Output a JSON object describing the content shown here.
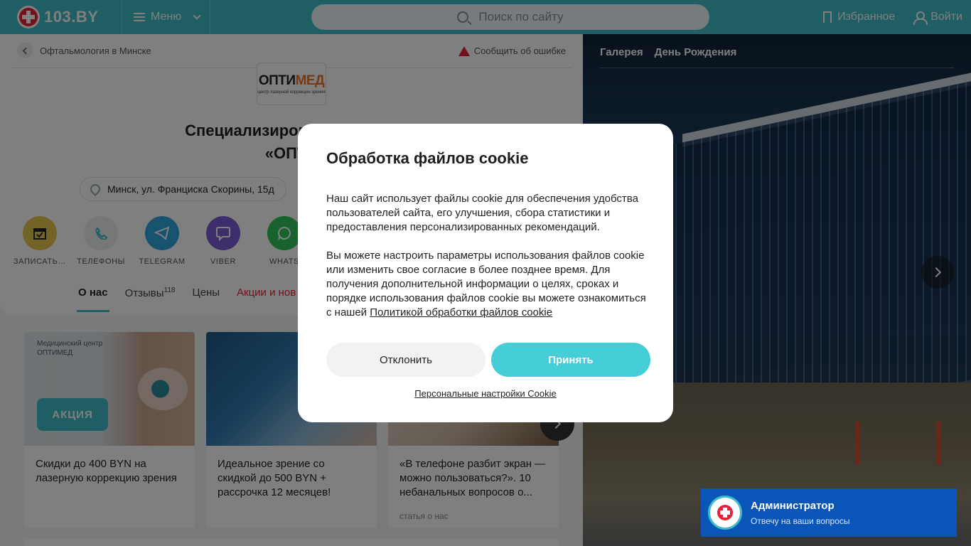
{
  "header": {
    "logo_text": "103.BY",
    "menu_label": "Меню",
    "search_placeholder": "Поиск по сайту",
    "favorites_label": "Избранное",
    "login_label": "Войти"
  },
  "breadcrumb": {
    "label": "Офтальмология в Минске"
  },
  "report_error_label": "Сообщить об ошибке",
  "clinic": {
    "logo_name_a": "ОПТИ",
    "logo_name_b": "МЕД",
    "logo_sub": "центр лазерной коррекции зрения",
    "title_line1": "Специализированный цент",
    "title_line2": "«ОПТИ",
    "address": "Минск, ул. Франциска Скорины, 15д"
  },
  "actions": [
    {
      "label": "ЗАПИСАТЬ…",
      "icon": "calendar-icon",
      "color": "#e6c84a"
    },
    {
      "label": "ТЕЛЕФОНЫ",
      "icon": "phone-icon",
      "color": "#eceeef"
    },
    {
      "label": "TELEGRAM",
      "icon": "telegram-icon",
      "color": "#2ea5dc"
    },
    {
      "label": "VIBER",
      "icon": "viber-icon",
      "color": "#7b5cd6"
    },
    {
      "label": "WHATS",
      "icon": "whatsapp-icon",
      "color": "#2fc45a"
    }
  ],
  "tabs": [
    {
      "label": "О нас",
      "active": true
    },
    {
      "label": "Отзывы",
      "count": "118"
    },
    {
      "label": "Цены"
    },
    {
      "label": "Акции и нов"
    }
  ],
  "promos": [
    {
      "image_label_line1": "Медицинский центр",
      "image_label_line2": "ОПТИМЕД",
      "badge": "АКЦИЯ",
      "text": "Скидки до 400 BYN на лазерную коррекцию зрения"
    },
    {
      "text": "Идеальное зрение со скидкой до 500 BYN + рассрочка 12 месяцев!"
    },
    {
      "text": "«В телефоне разбит экран — можно пользоваться?». 10 небанальных вопросов о...",
      "tag": "статья о нас"
    }
  ],
  "gallery": {
    "tabs": [
      "Галерея",
      "День Рождения"
    ]
  },
  "admin_widget": {
    "name": "Администратор",
    "subtitle": "Отвечу на ваши вопросы"
  },
  "cookie_modal": {
    "title": "Обработка файлов cookie",
    "paragraph1": "Наш сайт использует файлы cookie для обеспечения удобства пользователей сайта, его улучшения, сбора статистики и предоставления персонализированных рекомендаций.",
    "paragraph2": "Вы можете настроить параметры использования файлов cookie или изменить свое согласие в более позднее время. Для получения дополнительной информации о целях, сроках и порядке использования файлов cookie вы можете ознакомиться с нашей",
    "policy_link": "Политикой обработки файлов cookie",
    "decline_label": "Отклонить",
    "accept_label": "Принять",
    "settings_link": "Персональные настройки Cookie"
  }
}
